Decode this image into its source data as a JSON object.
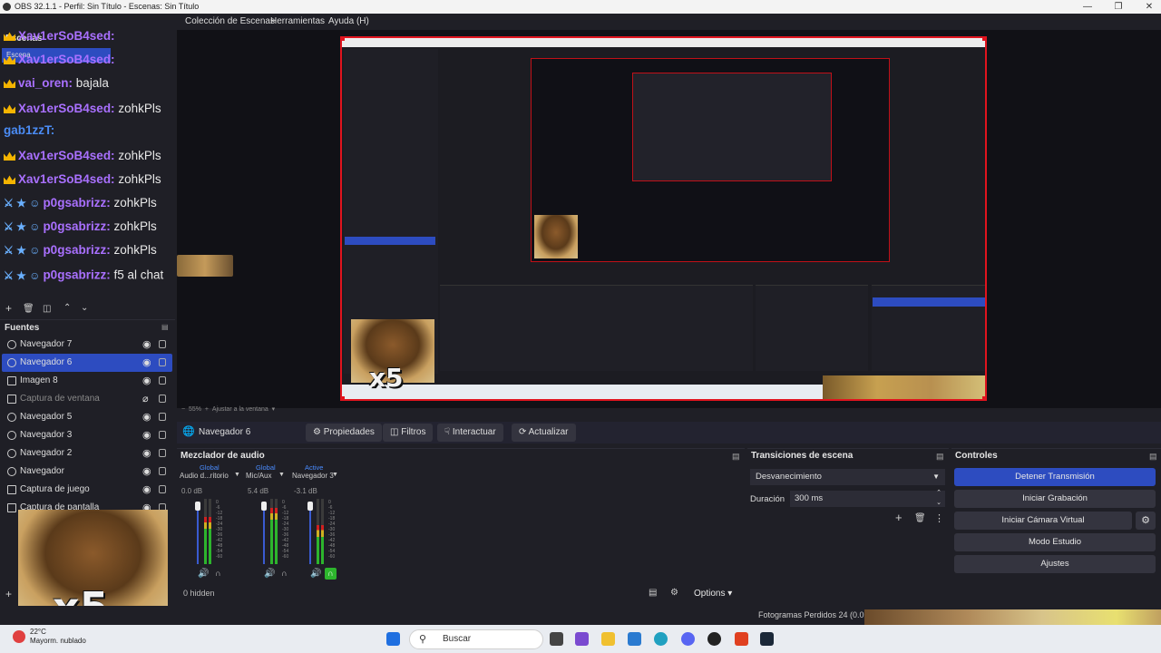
{
  "window": {
    "title": "OBS 32.1.1 - Perfil: Sin Título - Escenas: Sin Título"
  },
  "menu": [
    "Colección de Escenas",
    "Herramientas",
    "Ayuda (H)"
  ],
  "scenes": {
    "title": "Escenas",
    "item": "Escena"
  },
  "chat": [
    {
      "user": "Xav1erSoB4sed:",
      "msg": "",
      "badge": "crown",
      "cls": ""
    },
    {
      "user": "Xav1erSoB4sed:",
      "msg": "",
      "badge": "crown",
      "cls": ""
    },
    {
      "user": "vai_oren:",
      "msg": "bajala",
      "badge": "crown",
      "cls": ""
    },
    {
      "user": "Xav1erSoB4sed:",
      "msg": "zohkPls",
      "badge": "crown",
      "cls": ""
    },
    {
      "user": "gab1zzT:",
      "msg": "",
      "badge": "none",
      "cls": "blue"
    },
    {
      "user": "Xav1erSoB4sed:",
      "msg": "zohkPls",
      "badge": "crown",
      "cls": ""
    },
    {
      "user": "Xav1erSoB4sed:",
      "msg": "zohkPls",
      "badge": "crown",
      "cls": ""
    },
    {
      "user": "p0gsabrizz:",
      "msg": "zohkPls",
      "badge": "sword",
      "cls": ""
    },
    {
      "user": "p0gsabrizz:",
      "msg": "zohkPls",
      "badge": "sword",
      "cls": ""
    },
    {
      "user": "p0gsabrizz:",
      "msg": "zohkPls",
      "badge": "sword",
      "cls": ""
    },
    {
      "user": "p0gsabrizz:",
      "msg": "f5 al chat",
      "badge": "sword",
      "cls": ""
    }
  ],
  "sources": {
    "title": "Fuentes",
    "items": [
      {
        "label": "Navegador 7",
        "state": "normal",
        "icon": "globe-icon"
      },
      {
        "label": "Navegador 6",
        "state": "selected",
        "icon": "globe-icon"
      },
      {
        "label": "Imagen 8",
        "state": "normal",
        "icon": "image-icon"
      },
      {
        "label": "Captura de ventana",
        "state": "hidden",
        "icon": "window-icon"
      },
      {
        "label": "Navegador 5",
        "state": "normal",
        "icon": "globe-icon"
      },
      {
        "label": "Navegador 3",
        "state": "normal",
        "icon": "globe-icon"
      },
      {
        "label": "Navegador 2",
        "state": "normal",
        "icon": "globe-icon"
      },
      {
        "label": "Navegador",
        "state": "normal",
        "icon": "globe-icon"
      },
      {
        "label": "Captura de juego",
        "state": "normal",
        "icon": "gamepad-icon"
      },
      {
        "label": "Captura de pantalla",
        "state": "normal",
        "icon": "monitor-icon"
      }
    ]
  },
  "preview": {
    "zoom": "55%",
    "fit": "Ajustar a la ventana",
    "overlay_text": "x5"
  },
  "context": {
    "source_name": "Navegador 6",
    "buttons": {
      "props": "Propiedades",
      "filters": "Filtros",
      "interact": "Interactuar",
      "refresh": "Actualizar"
    }
  },
  "mixer": {
    "title": "Mezclador de audio",
    "headers": [
      "Global",
      "Global",
      "Active"
    ],
    "channels": [
      {
        "name": "Audio d...ritorio",
        "db": "0.0 dB",
        "level": 0.72
      },
      {
        "name": "Mic/Aux",
        "db": "5.4 dB",
        "level": 0.86
      },
      {
        "name": "Navegador 3",
        "db": "-3.1 dB",
        "level": 0.6
      }
    ],
    "scale": [
      "0",
      "-6",
      "-12",
      "-18",
      "-24",
      "-30",
      "-36",
      "-42",
      "-48",
      "-54",
      "-60"
    ],
    "hidden": "0 hidden",
    "options": "Options"
  },
  "transitions": {
    "title": "Transiciones de escena",
    "type": "Desvanecimiento",
    "duration_label": "Duración",
    "duration_value": "300 ms"
  },
  "controls": {
    "title": "Controles",
    "stop_stream": "Detener Transmisión",
    "start_rec": "Iniciar Grabación",
    "start_vcam": "Iniciar Cámara Virtual",
    "studio": "Modo Estudio",
    "settings": "Ajustes"
  },
  "status": {
    "dropped": "Fotogramas Perdidos 24 (0.0"
  },
  "taskbar": {
    "temp": "22°C",
    "weather": "Mayorm. nublado",
    "search": "Buscar"
  },
  "colors": {
    "accent": "#2d4cc0",
    "live_border": "#e0141e",
    "meter_green": "#2db52d"
  }
}
